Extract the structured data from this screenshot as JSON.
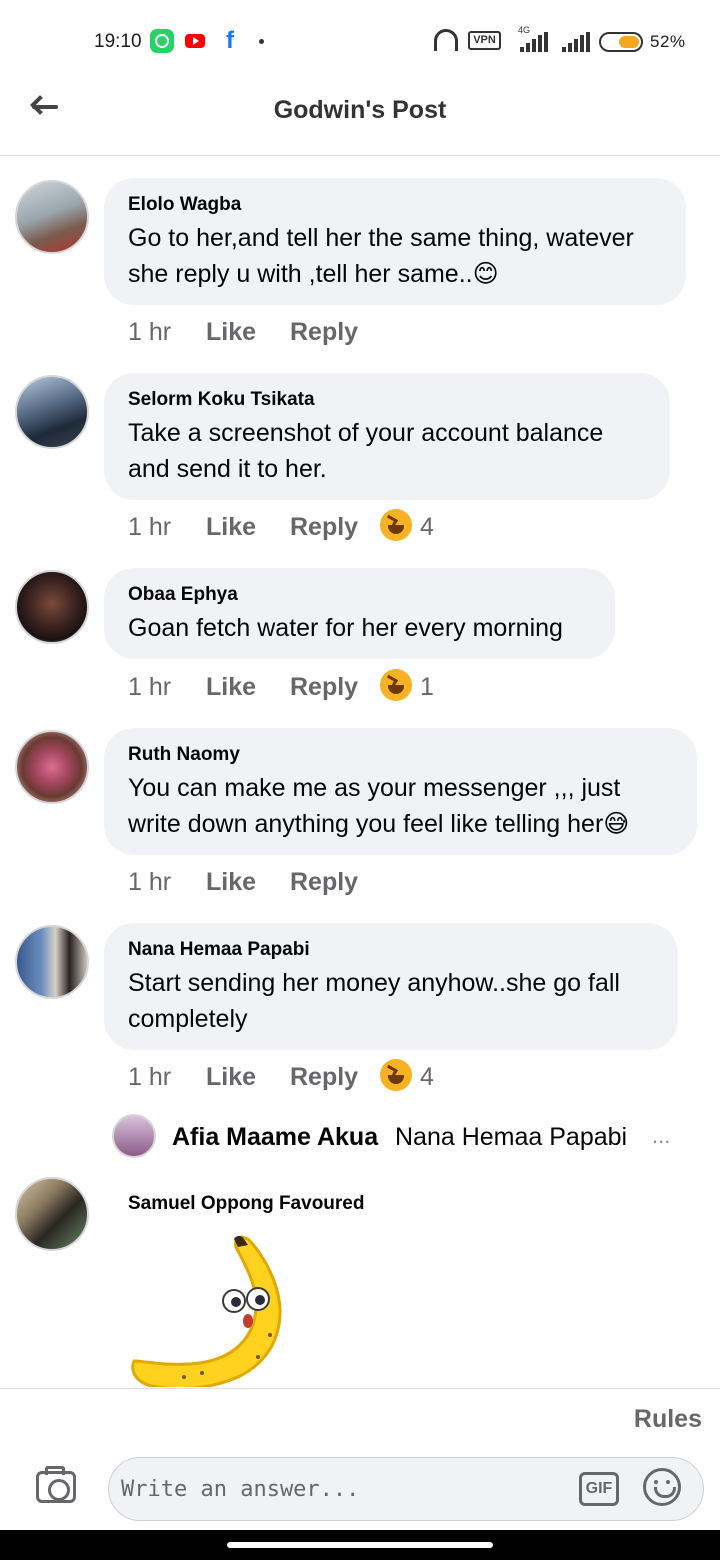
{
  "status_bar": {
    "time": "19:10",
    "vpn_label": "VPN",
    "network_label": "4G",
    "battery_percent": "52%",
    "battery_level": 0.52,
    "notification_icons": [
      "whatsapp-icon",
      "youtube-icon",
      "facebook-icon"
    ]
  },
  "header": {
    "title": "Godwin's Post"
  },
  "comments": [
    {
      "author": "Elolo Wagba",
      "text": "Go to her,and tell her the same thing, watever she reply u with ,tell her same..😊",
      "time": "1 hr",
      "like": "Like",
      "reply": "Reply"
    },
    {
      "author": "Selorm Koku Tsikata",
      "text": " Take a screenshot of your account balance and send it to her.",
      "time": "1 hr",
      "like": "Like",
      "reply": "Reply",
      "reaction_count": "4"
    },
    {
      "author": "Obaa Ephya",
      "text": "Goan fetch water for her every morning",
      "time": "1 hr",
      "like": "Like",
      "reply": "Reply",
      "reaction_count": "1"
    },
    {
      "author": "Ruth Naomy",
      "text": "You can make me as your messenger ,,, just write down anything you feel like telling her😅",
      "time": "1 hr",
      "like": "Like",
      "reply": "Reply"
    },
    {
      "author": "Nana Hemaa Papabi",
      "text": "Start sending her money anyhow..she go fall completely",
      "time": "1 hr",
      "like": "Like",
      "reply": "Reply",
      "reaction_count": "4"
    }
  ],
  "reply_preview": {
    "author": "Afia Maame Akua",
    "text": "Nana Hemaa Papabi",
    "more": "..."
  },
  "last_comment": {
    "author": "Samuel Oppong Favoured",
    "sticker": "banana-sticker"
  },
  "composer": {
    "rules_label": "Rules",
    "placeholder": "Write an answer...",
    "gif_label": "GIF"
  }
}
